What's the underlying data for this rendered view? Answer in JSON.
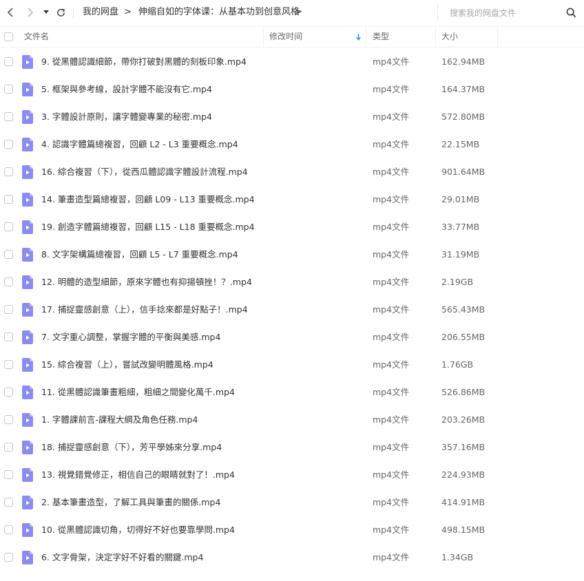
{
  "nav": {
    "back_icon": "chevron-left-icon",
    "forward_icon": "chevron-right-icon",
    "dropdown_icon": "caret-down-icon",
    "refresh_icon": "refresh-icon"
  },
  "breadcrumb": {
    "root": "我的网盘",
    "separator": ">",
    "current": "伸缩自如的字体课：从基本功到创意风格",
    "trailing_separator": ">"
  },
  "search": {
    "placeholder": "搜索我的网盘文件",
    "icon": "search-icon"
  },
  "columns": {
    "name": "文件名",
    "modified": "修改时间",
    "type": "类型",
    "size": "大小",
    "sort_indicator": "sort-down-arrow-icon"
  },
  "colors": {
    "accent": "#2f97ee",
    "file_icon": "#8b8cf0",
    "text": "#333333",
    "muted": "#666666"
  },
  "files": [
    {
      "name": "9. 從黑體認識細節，帶你打破對黑體的刻板印象.mp4",
      "type": "mp4文件",
      "size": "162.94MB"
    },
    {
      "name": "5. 框架與參考線，設計字體不能沒有它.mp4",
      "type": "mp4文件",
      "size": "164.37MB"
    },
    {
      "name": "3. 字體設計原則，讓字體變專業的秘密.mp4",
      "type": "mp4文件",
      "size": "572.80MB"
    },
    {
      "name": "4. 認識字體篇總複習，回顧 L2 - L3 重要概念.mp4",
      "type": "mp4文件",
      "size": "22.15MB"
    },
    {
      "name": "16. 綜合複習（下），從西瓜體認識字體設計流程.mp4",
      "type": "mp4文件",
      "size": "901.64MB"
    },
    {
      "name": "14. 筆畫造型篇總複習，回顧 L09 - L13 重要概念.mp4",
      "type": "mp4文件",
      "size": "29.01MB"
    },
    {
      "name": "19. 創造字體篇總複習，回顧 L15 - L18 重要概念.mp4",
      "type": "mp4文件",
      "size": "33.77MB"
    },
    {
      "name": "8. 文字架構篇總複習，回顧 L5 - L7 重要概念.mp4",
      "type": "mp4文件",
      "size": "31.19MB"
    },
    {
      "name": "12. 明體的造型細節，原來字體也有抑揚頓挫！？.mp4",
      "type": "mp4文件",
      "size": "2.19GB"
    },
    {
      "name": "17. 捕捉靈感創意（上），信手捻來都是好點子！.mp4",
      "type": "mp4文件",
      "size": "565.43MB"
    },
    {
      "name": "7. 文字重心調整，掌握字體的平衡與美感.mp4",
      "type": "mp4文件",
      "size": "206.55MB"
    },
    {
      "name": "15. 綜合複習（上），嘗試改變明體風格.mp4",
      "type": "mp4文件",
      "size": "1.76GB"
    },
    {
      "name": "11. 從黑體認識筆畫粗細，粗細之間變化萬千.mp4",
      "type": "mp4文件",
      "size": "526.86MB"
    },
    {
      "name": "1. 字體課前言-課程大綱及角色任務.mp4",
      "type": "mp4文件",
      "size": "203.26MB"
    },
    {
      "name": "18. 捕捉靈感創意（下），芳平學姊來分享.mp4",
      "type": "mp4文件",
      "size": "357.16MB"
    },
    {
      "name": "13. 視覺錯覺修正，相信自己的眼睛就對了！.mp4",
      "type": "mp4文件",
      "size": "224.93MB"
    },
    {
      "name": "2. 基本筆畫造型，了解工具與筆畫的關係.mp4",
      "type": "mp4文件",
      "size": "414.91MB"
    },
    {
      "name": "10. 從黑體認識切角，切得好不好也要靠學問.mp4",
      "type": "mp4文件",
      "size": "498.15MB"
    },
    {
      "name": "6. 文字骨架，決定字好不好看的關鍵.mp4",
      "type": "mp4文件",
      "size": "1.34GB"
    }
  ]
}
